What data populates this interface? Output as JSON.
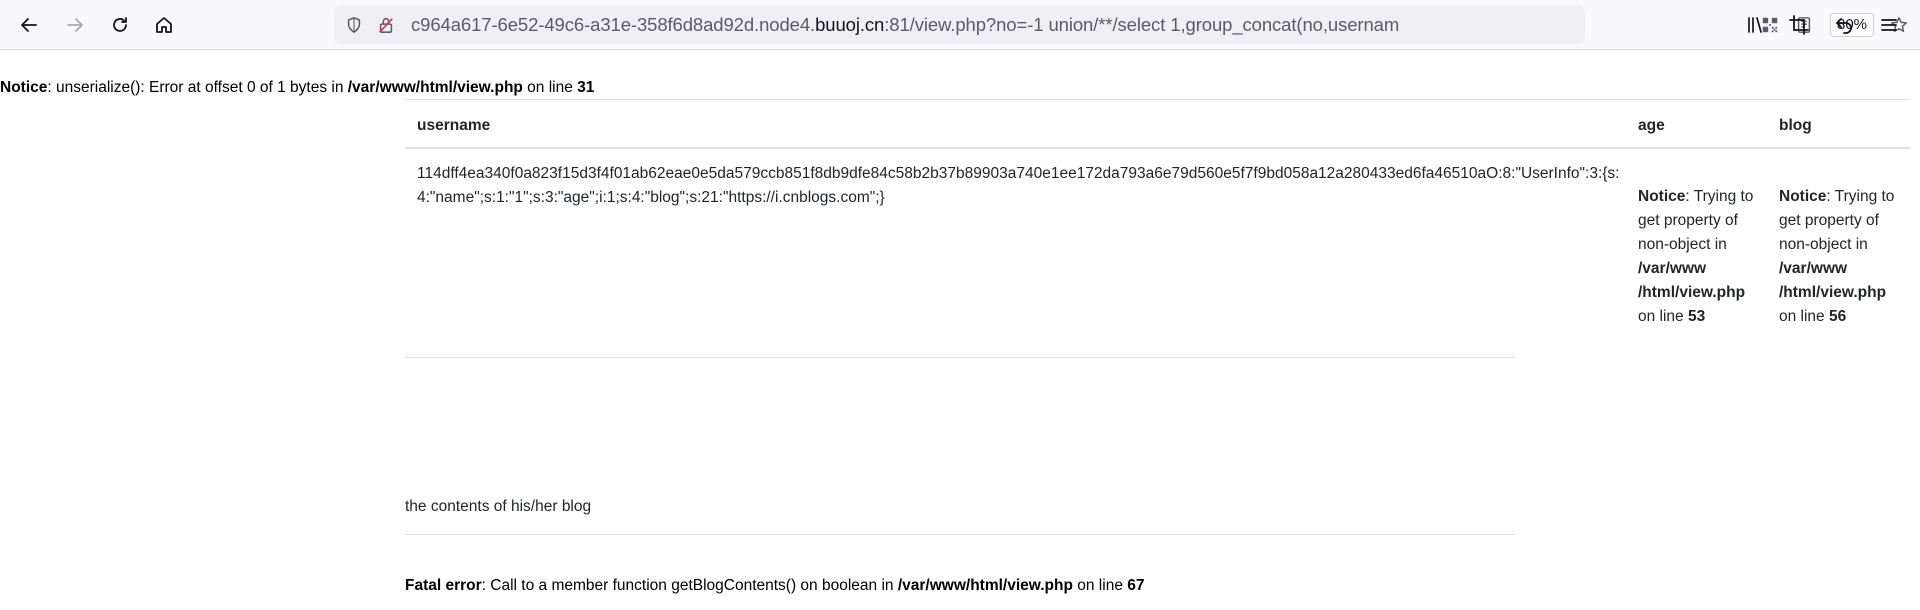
{
  "browser": {
    "url_prefix": "c964a617-6e52-49c6-a31e-358f6d8ad92d.node4.",
    "url_host": "buuoj.cn",
    "url_suffix": ":81/view.php?no=-1 union/**/select 1,group_concat(no,usernam",
    "zoom": "80%",
    "icons": [
      "back-arrow-icon",
      "forward-arrow-icon",
      "reload-icon",
      "home-icon",
      "shield-icon",
      "insecure-lock-icon",
      "qr-code-icon",
      "reader-view-icon",
      "bookmark-star-icon",
      "library-icon",
      "screenshot-crop-icon",
      "undo-arrow-icon",
      "hamburger-menu-icon"
    ]
  },
  "page": {
    "notice_top": {
      "label": "Notice",
      "message": ": unserialize(): Error at offset 0 of 1 bytes in ",
      "file": "/var/www/html/view.php",
      "on_line": " on line ",
      "line": "31"
    },
    "table": {
      "headers": {
        "username": "username",
        "age": "age",
        "blog": "blog"
      },
      "username_value": "114dff4ea340f0a823f15d3f4f01ab62eae0e5da579ccb851f8db9dfe84c58b2b37b89903a740e1ee172da793a6e79d560e5f7f9bd058a12a280433ed6fa46510aO:8:\"UserInfo\":3:{s:4:\"name\";s:1:\"1\";s:3:\"age\";i:1;s:4:\"blog\";s:21:\"https://i.cnblogs.com\";}",
      "age_notice": {
        "label": "Notice",
        "message": ": Trying to get property of non-object in ",
        "file": "/var/www /html/view.php",
        "on_line": " on line ",
        "line": "53"
      },
      "blog_notice": {
        "label": "Notice",
        "message": ": Trying to get property of non-object in ",
        "file": "/var/www /html/view.php",
        "on_line": " on line ",
        "line": "56"
      }
    },
    "blog_contents_label": "the contents of his/her blog",
    "fatal": {
      "label": "Fatal error",
      "message": ": Call to a member function getBlogContents() on boolean in ",
      "file": "/var/www/html/view.php",
      "on_line": " on line ",
      "line": "67"
    }
  }
}
